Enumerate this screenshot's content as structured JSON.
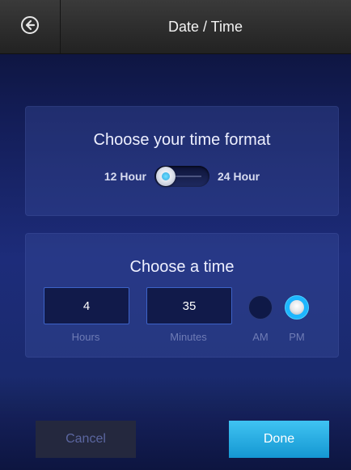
{
  "header": {
    "title": "Date / Time",
    "back_icon": "arrow-left-circle-icon"
  },
  "format_panel": {
    "title": "Choose your time format",
    "left_label": "12 Hour",
    "right_label": "24 Hour",
    "selected": "12 Hour"
  },
  "time_panel": {
    "title": "Choose a time",
    "hours_value": "4",
    "hours_label": "Hours",
    "minutes_value": "35",
    "minutes_label": "Minutes",
    "am_label": "AM",
    "pm_label": "PM",
    "selected_period": "PM"
  },
  "footer": {
    "cancel_label": "Cancel",
    "done_label": "Done"
  },
  "colors": {
    "accent": "#1db6ff",
    "done_button": "#29a9e0"
  }
}
